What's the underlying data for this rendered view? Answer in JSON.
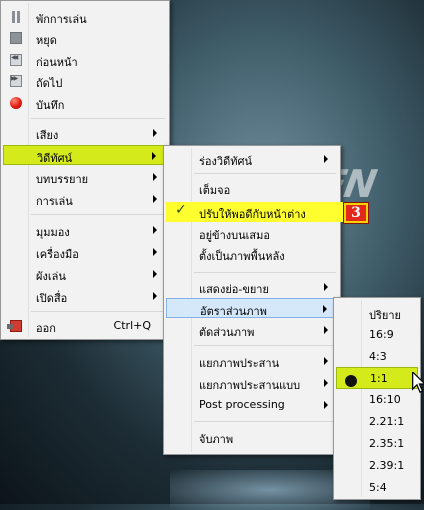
{
  "main_menu": {
    "items": [
      {
        "label": "พักการเล่น",
        "icon": "pause-icon"
      },
      {
        "label": "หยุด",
        "icon": "stop-icon"
      },
      {
        "label": "ก่อนหน้า",
        "icon": "previous-icon"
      },
      {
        "label": "ถัดไป",
        "icon": "next-icon"
      },
      {
        "label": "บันทึก",
        "icon": "record-icon"
      },
      {
        "label": "เสียง"
      },
      {
        "label": "วิดีทัศน์"
      },
      {
        "label": "บทบรรยาย"
      },
      {
        "label": "การเล่น"
      },
      {
        "label": "มุมมอง"
      },
      {
        "label": "เครื่องมือ"
      },
      {
        "label": "ผังเล่น"
      },
      {
        "label": "เปิดสื่อ"
      },
      {
        "label": "ออก",
        "shortcut": "Ctrl+Q",
        "icon": "exit-icon"
      }
    ]
  },
  "video_menu": {
    "items": [
      {
        "label": "ร่องวิดีทัศน์"
      },
      {
        "label": "เต็มจอ"
      },
      {
        "label": "ปรับให้พอดีกับหน้าต่าง",
        "checked": true
      },
      {
        "label": "อยู่ข้างบนเสมอ"
      },
      {
        "label": "ตั้งเป็นภาพพื้นหลัง"
      },
      {
        "label": "แสดงย่อ-ขยาย"
      },
      {
        "label": "อัตราส่วนภาพ"
      },
      {
        "label": "ตัดส่วนภาพ"
      },
      {
        "label": "แยกภาพประสาน"
      },
      {
        "label": "แยกภาพประสานแบบ"
      },
      {
        "label": "Post processing"
      },
      {
        "label": "จับภาพ"
      }
    ]
  },
  "aspect_menu": {
    "items": [
      {
        "label": "ปริยาย"
      },
      {
        "label": "16:9"
      },
      {
        "label": "4:3"
      },
      {
        "label": "1:1",
        "selected": true
      },
      {
        "label": "16:10"
      },
      {
        "label": "2.21:1"
      },
      {
        "label": "2.35:1"
      },
      {
        "label": "2.39:1"
      },
      {
        "label": "5:4"
      }
    ]
  },
  "annotation": {
    "step_badge": "3"
  },
  "background": {
    "logo_fragment": "EN"
  },
  "colors": {
    "highlight_green": "#d4ea1a",
    "highlight_blue": "#d5e8fa",
    "highlight_yellow": "#ffff30",
    "badge_red": "#e4281b"
  }
}
